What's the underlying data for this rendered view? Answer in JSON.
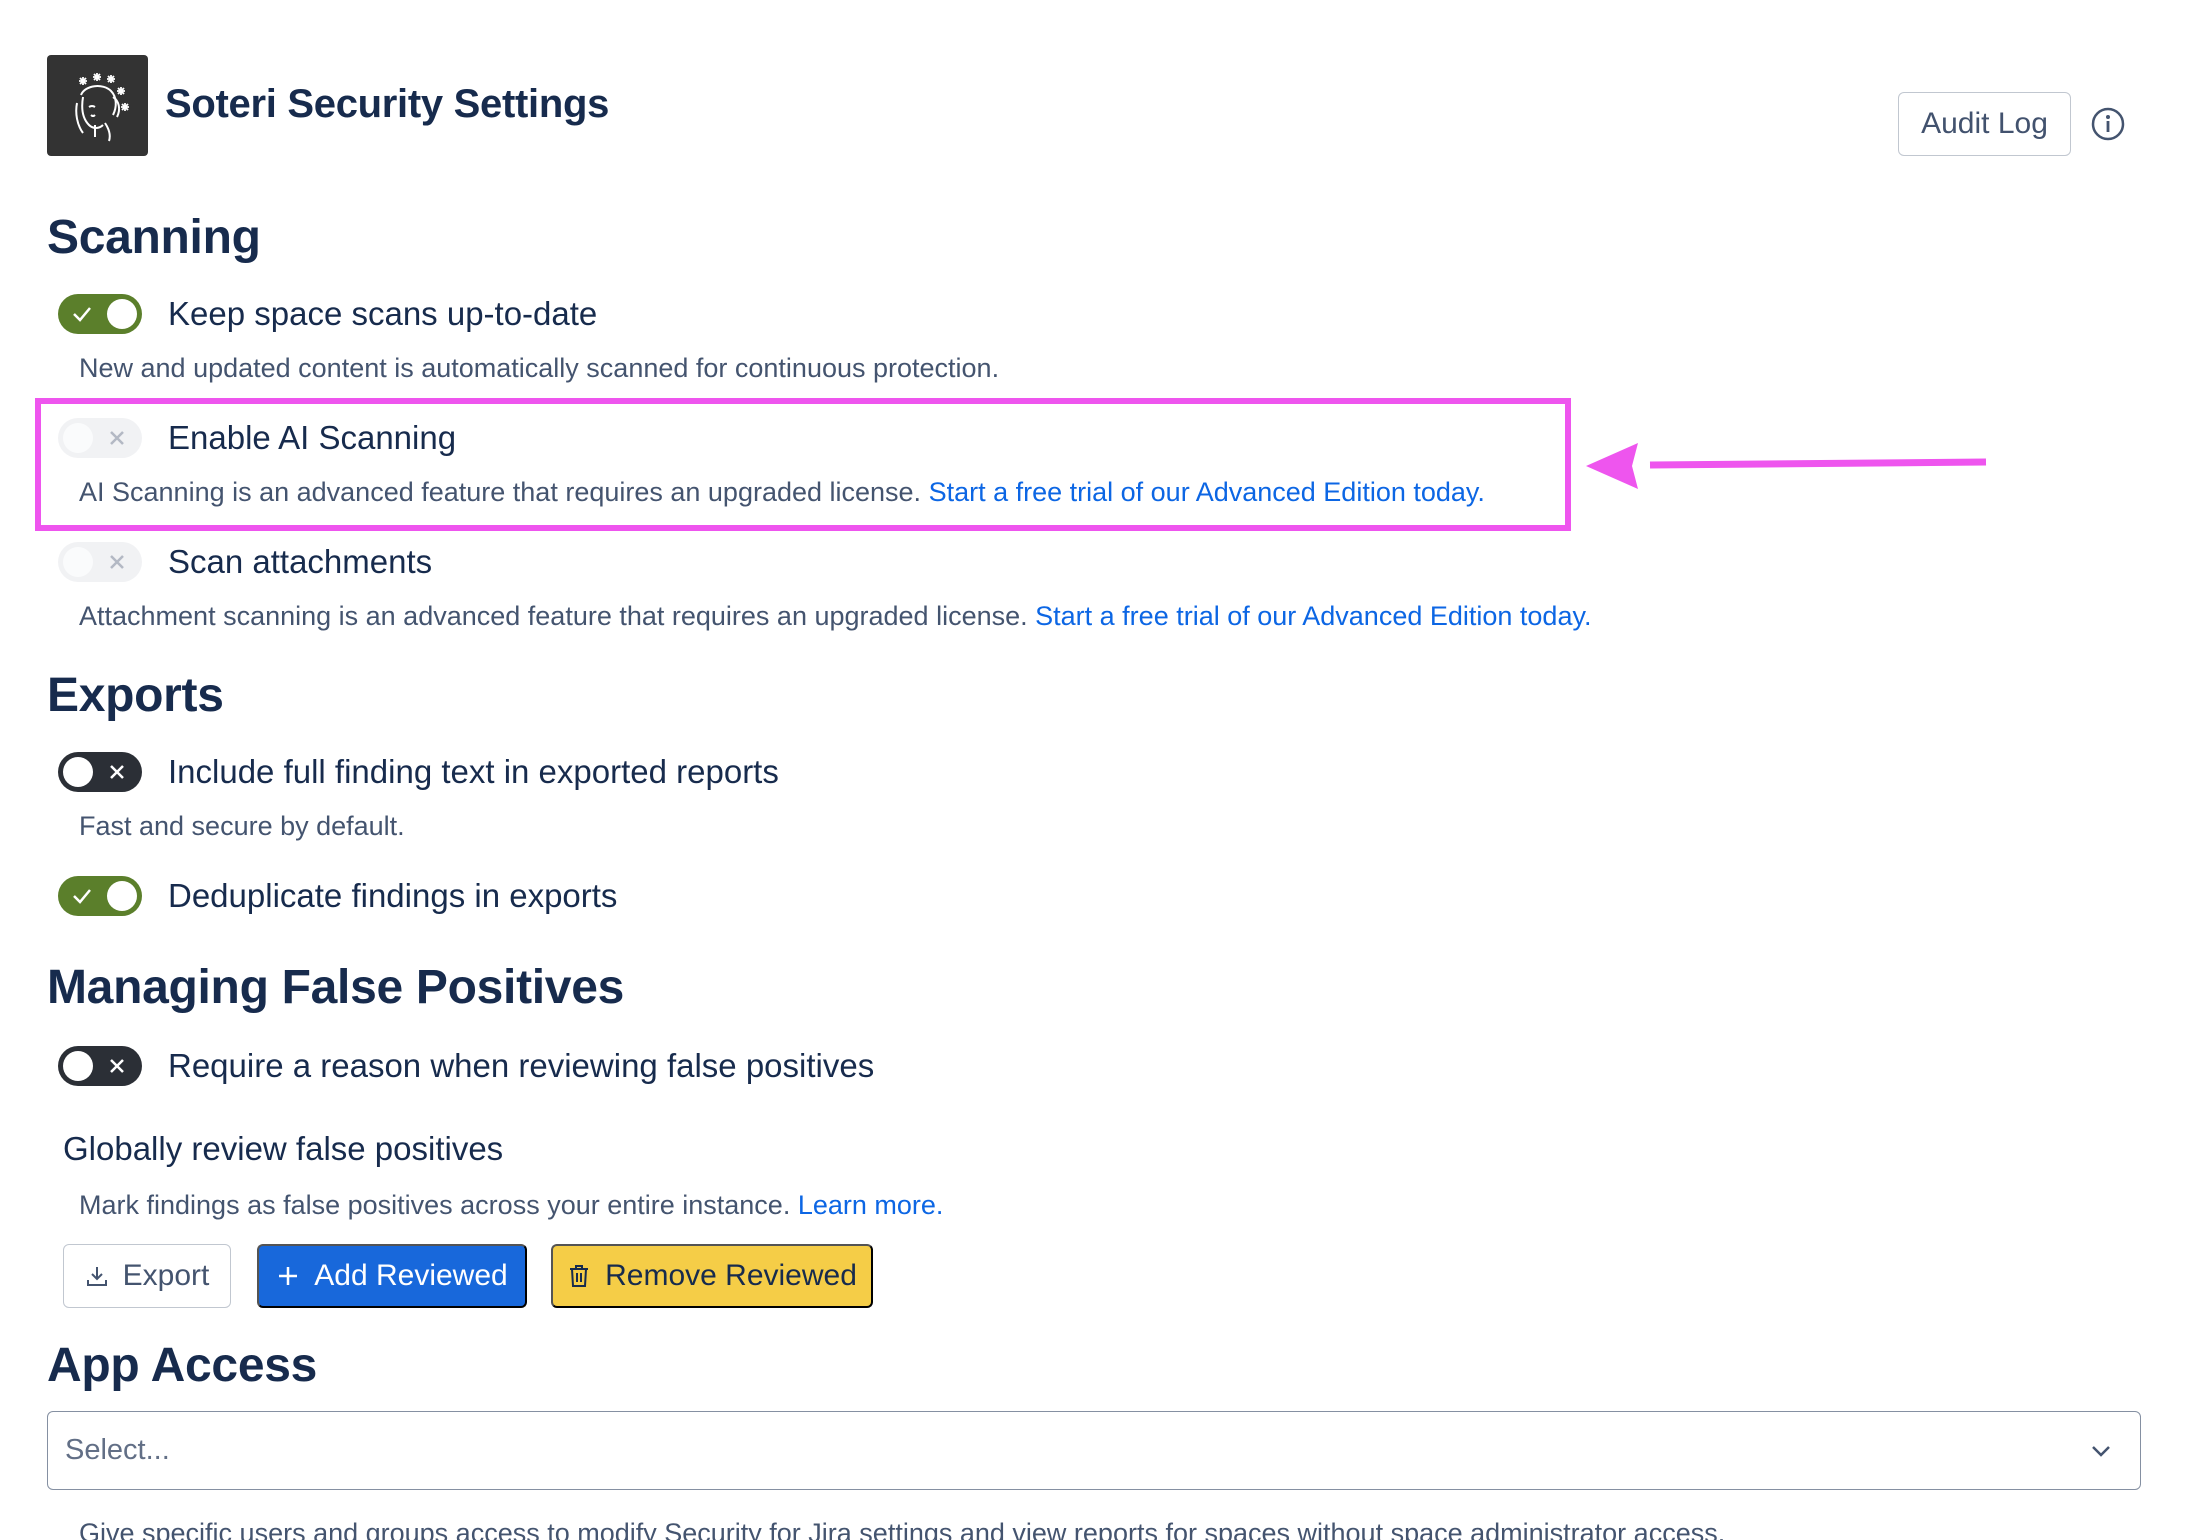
{
  "header": {
    "title": "Soteri Security Settings",
    "audit_log_label": "Audit Log"
  },
  "scanning": {
    "heading": "Scanning",
    "keep_scans": {
      "label": "Keep space scans up-to-date",
      "description": "New and updated content is automatically scanned for continuous protection.",
      "state": "on"
    },
    "ai_scanning": {
      "label": "Enable AI Scanning",
      "description": "AI Scanning is an advanced feature that requires an upgraded license.",
      "link": "Start a free trial of our Advanced Edition today.",
      "state": "disabled"
    },
    "attachments": {
      "label": "Scan attachments",
      "description": "Attachment scanning is an advanced feature that requires an upgraded license.",
      "link": "Start a free trial of our Advanced Edition today.",
      "state": "disabled"
    }
  },
  "exports": {
    "heading": "Exports",
    "full_text": {
      "label": "Include full finding text in exported reports",
      "description": "Fast and secure by default.",
      "state": "off"
    },
    "dedupe": {
      "label": "Deduplicate findings in exports",
      "state": "on"
    }
  },
  "false_positives": {
    "heading": "Managing False Positives",
    "require_reason": {
      "label": "Require a reason when reviewing false positives",
      "state": "off"
    },
    "global_review": {
      "title": "Globally review false positives",
      "description": "Mark findings as false positives across your entire instance.",
      "link": "Learn more."
    },
    "buttons": {
      "export": "Export",
      "add": "Add Reviewed",
      "remove": "Remove Reviewed"
    }
  },
  "app_access": {
    "heading": "App Access",
    "select_placeholder": "Select...",
    "description": "Give specific users and groups access to modify Security for Jira settings and view reports for spaces without space administrator access."
  },
  "colors": {
    "toggle_on": "#5b7f2b",
    "toggle_off": "#2b2f36",
    "link": "#0c66e4",
    "primary_button": "#1868db",
    "warning_button": "#f5cd47",
    "highlight": "#ee55ee"
  }
}
